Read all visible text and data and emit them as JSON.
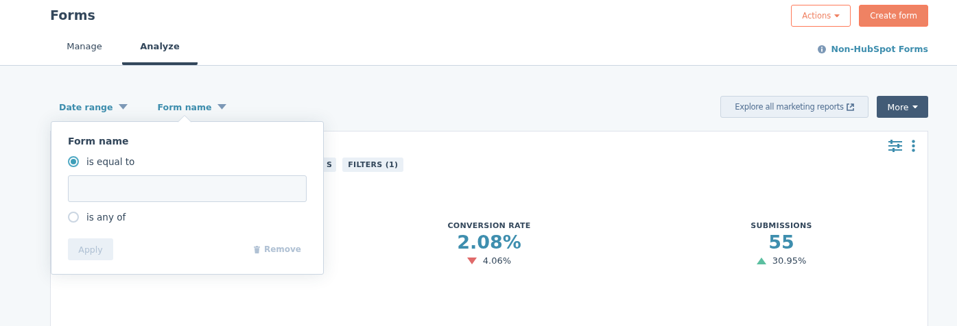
{
  "header": {
    "title": "Forms",
    "actions": [
      {
        "label": "Actions",
        "kind": "outline"
      },
      {
        "label": "Create form",
        "kind": "primary"
      }
    ]
  },
  "tabs": [
    {
      "label": "Manage",
      "selected": false
    },
    {
      "label": "Analyze",
      "selected": true
    }
  ],
  "side_link": "Non-HubSpot Forms",
  "filters": [
    {
      "label": "Date range"
    },
    {
      "label": "Form name"
    }
  ],
  "toolbar": {
    "explore": "Explore all marketing reports",
    "more": "More"
  },
  "card": {
    "tags": [
      "S",
      "FILTERS (1)"
    ],
    "metrics": [
      {
        "label": "CONVERSION RATE",
        "value": "2.08%",
        "change": "4.06%",
        "kind": "down"
      },
      {
        "label": "SUBMISSIONS",
        "value": "55",
        "change": "30.95%",
        "kind": "up"
      }
    ]
  },
  "popover": {
    "title": "Form name",
    "options": [
      {
        "label": "is equal to",
        "selected": true
      },
      {
        "label": "is any of",
        "selected": false
      }
    ],
    "apply": "Apply",
    "remove": "Remove"
  }
}
